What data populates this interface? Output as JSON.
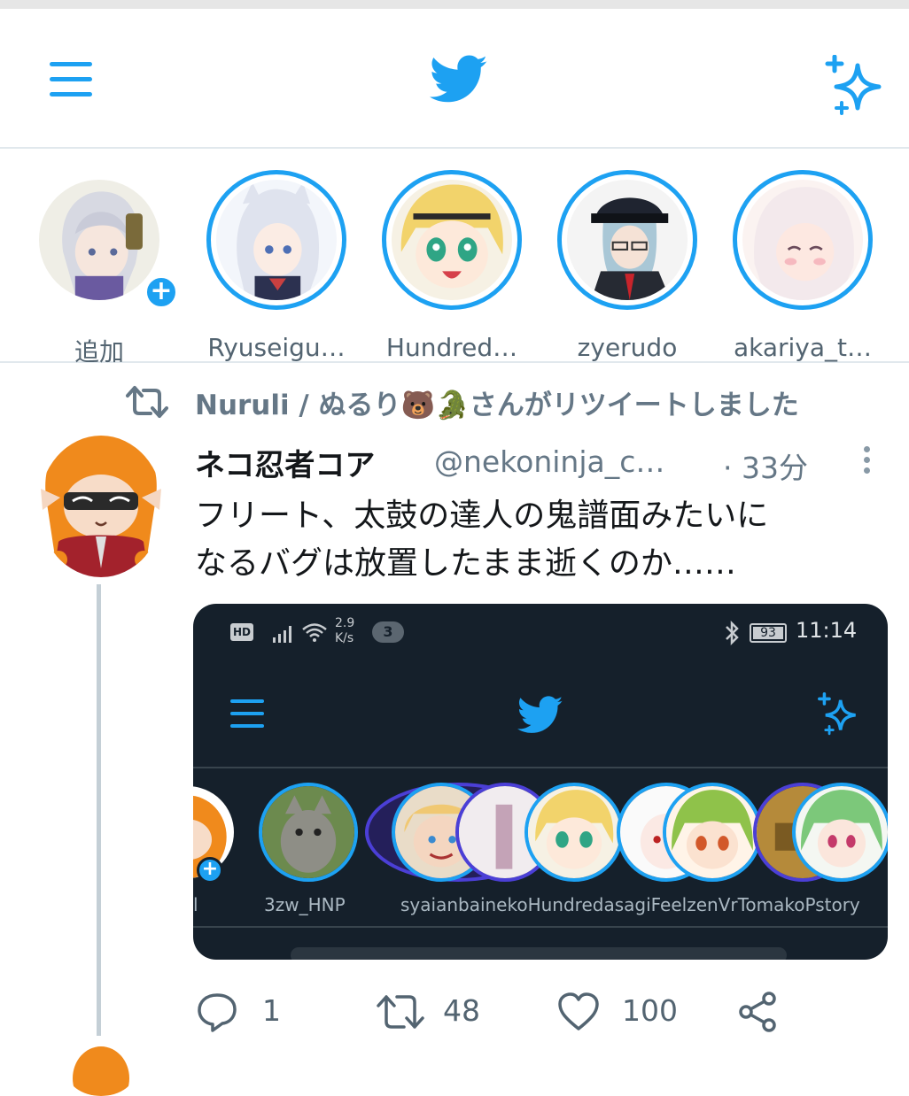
{
  "colors": {
    "accent": "#1da1f2",
    "text": "#14171a",
    "muted": "#657786",
    "border": "#e1e8ed",
    "media_bg": "#15202b"
  },
  "header": {
    "menu_icon": "hamburger-icon",
    "logo_icon": "twitter-bird-icon",
    "sparkle_icon": "sparkle-icon"
  },
  "fleets": [
    {
      "name": "追加",
      "has_ring": false,
      "add_badge": "+"
    },
    {
      "name": "Ryuseigu…",
      "has_ring": true
    },
    {
      "name": "Hundred…",
      "has_ring": true
    },
    {
      "name": "zyerudo",
      "has_ring": true
    },
    {
      "name": "akariya_t…",
      "has_ring": true
    }
  ],
  "tweet": {
    "retweet_context": "Nuruli / ぬるり🐻🐊さんがリツイートしました",
    "author_name": "ネコ忍者コア",
    "author_handle": "@nekoninja_c…",
    "time": "· 33分",
    "text_lines": [
      "フリート、太鼓の達人の鬼譜面みたいに",
      "なるバグは放置したまま逝くのか……"
    ],
    "media": {
      "status_hd": "HD",
      "status_speed_top": "2.9",
      "status_speed_bottom": "K/s",
      "status_badge": "3",
      "battery": "93",
      "clock": "11:14",
      "add_badge": "+",
      "fleet_names": [
        "l",
        "3zw_HNP",
        "syaianbainekoHundredasagiFeelzenVrTomakoPstory"
      ]
    },
    "actions": {
      "reply_count": "1",
      "retweet_count": "48",
      "like_count": "100"
    }
  }
}
